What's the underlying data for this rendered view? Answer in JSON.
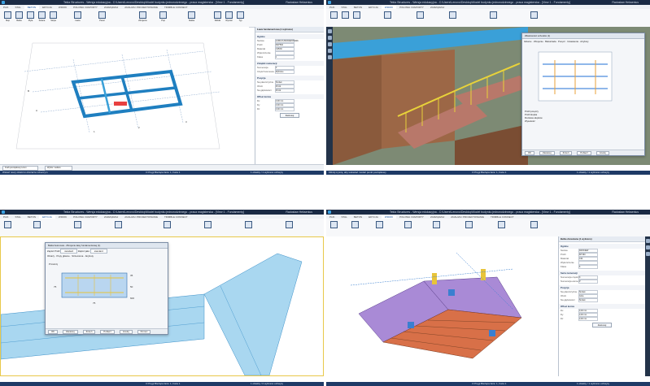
{
  "app": {
    "title": "Tekla Structures - Wersja edukacyjna - C:\\Users\\Lenovo\\Desktop\\Model budynku jednorodzinnego - praca magisterska - [View 1 - Fundamenty]",
    "user": "Radosław Heksenius",
    "tabs": [
      "PLIK",
      "STAL",
      "BETON",
      "EDYCJA",
      "WIDOK",
      "POLOWA I RAPORTY",
      "ZARZĄDZAJ",
      "ANALIZA I PROJEKTOWANIE",
      "TRIMBLE CONNECT"
    ]
  },
  "q1": {
    "active_tab": "BETON",
    "ribbon": [
      "Słup",
      "Belka",
      "Płyta",
      "Ściana",
      "Stopa",
      "Ława",
      "Panel",
      "Zbrojenie",
      "Pręt",
      "Siatka",
      "Widoki",
      "Wymiar",
      "Typ"
    ],
    "panel": {
      "header": "Ława fundamentowa (1 wybrano)",
      "sections": [
        {
          "title": "Ogólne",
          "rows": [
            [
              "Nazwa",
              "ŁAWA FUNDAMENTOWA"
            ],
            [
              "Profil",
              "600*500"
            ],
            [
              "Materiał",
              "C25/30"
            ],
            [
              "Wykończenie",
              ""
            ],
            [
              "Klasa",
              "1"
            ]
          ]
        },
        {
          "title": "Zmiękki numeracji",
          "rows": [
            [
              "Numeracja",
              "F"
            ],
            [
              "Część betonowa",
              "Wybrane"
            ]
          ]
        },
        {
          "title": "Pozycja",
          "rows": [
            [
              "Na płaszczyźnie",
              "Środek"
            ],
            [
              "Obrót",
              "Przód"
            ],
            [
              "Na głębokości",
              "Przód"
            ]
          ]
        },
        {
          "title": "Offset końca",
          "rows": [
            [
              "Dx",
              "0,00 mm"
            ],
            [
              "Dy",
              "0,00 mm"
            ],
            [
              "Dz",
              "0,00 mm"
            ]
          ]
        }
      ],
      "apply_label": "Zastosuj",
      "more_label": "Podgląd i edycja ustawień"
    },
    "bottom": {
      "phase": "Kraft początkowy Hmm",
      "select": "Wybór modelu"
    },
    "status": {
      "left": "Wskaż nowy obiekt w obszarze roboczym",
      "mid": "O  Pręgi Bieżąca faza: 1, Faza 1",
      "right": "1 obiekty / 1 wybrano uchwyty"
    }
  },
  "q2": {
    "active_tab": "WIDOK",
    "dialog": {
      "title": "Właściwości schodów (1)",
      "tabs": [
        "Główne",
        "Zbrojenie",
        "Balustrada",
        "Poręcz",
        "Ustawienia",
        "Atrybuty"
      ],
      "labels": [
        "Profil poręczy",
        "Profil słupka",
        "Rozstaw słupków",
        "Wysokość",
        "Materiał",
        "Klasa",
        "Prefiks"
      ],
      "buttons": [
        "OK",
        "Zastosuj",
        "Zmień",
        "Pobierz",
        "Anuluj"
      ]
    },
    "status": {
      "left": "Kliknij myszą, aby wskazać model/ punkt początkowy",
      "mid": "O  Pręgi Bieżąca faza: 1, Faza 1",
      "right": "1 obiekty / 1 wybrano uchwyty"
    }
  },
  "q3": {
    "active_tab": "EDYCJA",
    "dialog": {
      "title": "Belka betonowa - Zbrojenie ławy fundamentowej (1)",
      "fields": [
        "Zapisz",
        "Profil",
        "standard",
        "Zapisz jako",
        "standard"
      ],
      "tabs": [
        "Obrazy",
        "Pręty główne",
        "Strzemiona",
        "Atrybuty"
      ],
      "dims": [
        "Przekrój",
        "35",
        "50",
        "600",
        "75",
        "75"
      ],
      "buttons": [
        "OK",
        "Zastosuj",
        "Zmień",
        "Pobierz",
        "Anuluj",
        "Pomoc"
      ]
    },
    "status": {
      "left": "",
      "mid": "O  Pręgi Bieżąca faza: 1, Faza 1",
      "right": "1 obiekty / 0 wybrano uchwyty"
    }
  },
  "q4": {
    "active_tab": "WIDOK",
    "panel": {
      "header": "Belka drewniana (1 wybrano)",
      "sections": [
        {
          "title": "Ogólne",
          "rows": [
            [
              "Nazwa",
              "KROKIEW"
            ],
            [
              "Profil",
              "80*160"
            ],
            [
              "Materiał",
              "C24"
            ],
            [
              "Wykończenie",
              ""
            ],
            [
              "Klasa",
              "6"
            ]
          ]
        },
        {
          "title": "Seria numeracji",
          "rows": [
            [
              "Numeracja części",
              "K"
            ],
            [
              "Numeracja elementu",
              "P"
            ]
          ]
        },
        {
          "title": "Pozycja",
          "rows": [
            [
              "Na płaszczyźnie",
              "Środek"
            ],
            [
              "Obrót",
              "Góra"
            ],
            [
              "Na głębokości",
              "Środek"
            ]
          ]
        },
        {
          "title": "Offset końca",
          "rows": [
            [
              "Dx",
              "0,00 mm"
            ],
            [
              "Dy",
              "0,00 mm"
            ],
            [
              "Dz",
              "0,00 mm"
            ]
          ]
        }
      ],
      "apply_label": "Zastosuj",
      "more_label": "Pokaż więcej właściwości"
    },
    "status": {
      "left": "",
      "mid": "O  Pręgi Bieżąca faza: 1, Faza 1",
      "right": "1 obiekty / 1 wybrano uchwyty"
    }
  },
  "colors": {
    "titlebar": "#1a2a44",
    "status": "#1e3a66",
    "beam_blue": "#3aa0d8",
    "wall_brown": "#8a5a3c",
    "stair_yellow": "#e8d23a",
    "roof_orange": "#d87048",
    "roof_purple": "#a98ad6"
  }
}
